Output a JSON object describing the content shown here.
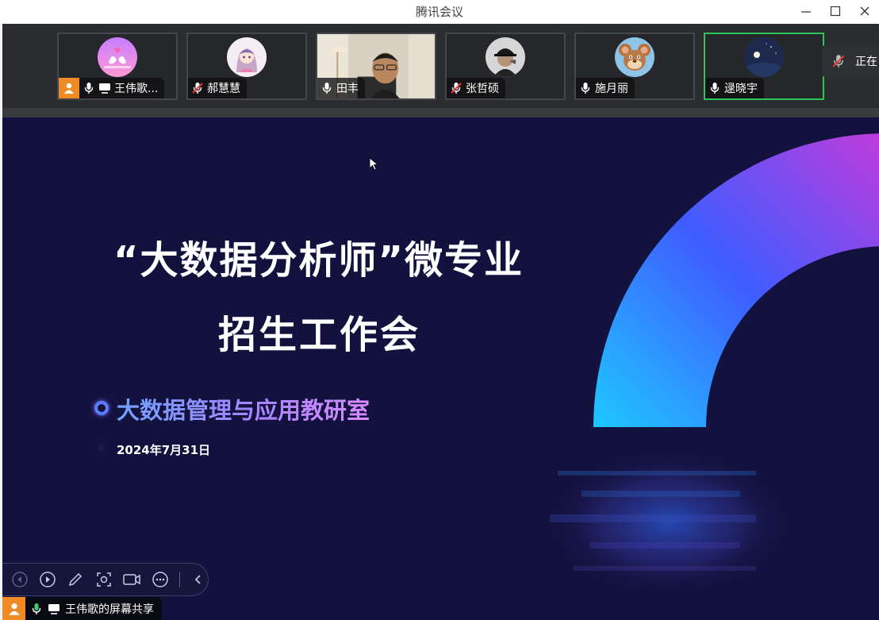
{
  "window": {
    "title": "腾讯会议"
  },
  "participants": [
    {
      "name": "王伟歌...",
      "mic": "on",
      "host": true,
      "sharing": true,
      "avatar": "swan-hearts-avatar"
    },
    {
      "name": "郝慧慧",
      "mic": "muted",
      "host": false,
      "avatar": "anime-girl-avatar"
    },
    {
      "name": "田丰",
      "mic": "on",
      "host": false,
      "avatar": "live-video"
    },
    {
      "name": "张哲硕",
      "mic": "muted",
      "host": false,
      "avatar": "cap-person-avatar"
    },
    {
      "name": "施月丽",
      "mic": "on",
      "host": false,
      "avatar": "cartoon-mouse-avatar"
    },
    {
      "name": "逯晓宇",
      "mic": "on",
      "host": false,
      "active_speaker": true,
      "avatar": "night-sky-avatar"
    }
  ],
  "status_pill": {
    "text": "正在"
  },
  "slide": {
    "title_line1": "“大数据分析师”微专业",
    "title_line2": "招生工作会",
    "org": "大数据管理与应用教研室",
    "date": "2024年7月31日"
  },
  "share_bar": {
    "label": "王伟歌的屏幕共享"
  },
  "colors": {
    "host_badge": "#f08a24",
    "active_border": "#2ec45a",
    "slide_bg": "#13123f",
    "strip_bg": "#2b2c30"
  }
}
